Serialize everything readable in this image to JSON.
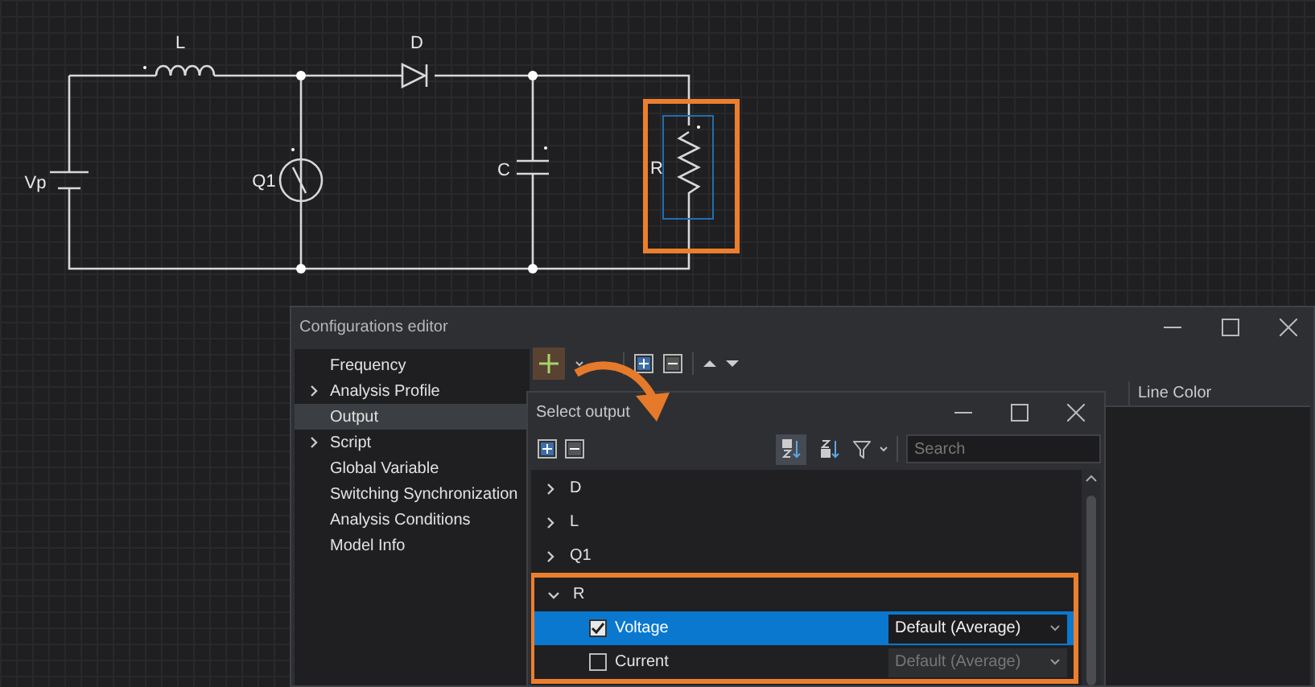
{
  "circuit": {
    "labels": [
      {
        "kind": "L",
        "text": "L"
      },
      {
        "kind": "D",
        "text": "D"
      },
      {
        "kind": "Vp",
        "text": "Vp"
      },
      {
        "kind": "Q1",
        "text": "Q1"
      },
      {
        "kind": "C",
        "text": "C"
      },
      {
        "kind": "R",
        "text": "R"
      }
    ]
  },
  "editor": {
    "title": "Configurations editor",
    "sidebar": [
      {
        "label": "Frequency",
        "expandable": false,
        "selected": false
      },
      {
        "label": "Analysis Profile",
        "expandable": true,
        "selected": false
      },
      {
        "label": "Output",
        "expandable": false,
        "selected": true
      },
      {
        "label": "Script",
        "expandable": true,
        "selected": false
      },
      {
        "label": "Global Variable",
        "expandable": false,
        "selected": false
      },
      {
        "label": "Switching Synchronization",
        "expandable": false,
        "selected": false
      },
      {
        "label": "Analysis Conditions",
        "expandable": false,
        "selected": false
      },
      {
        "label": "Model Info",
        "expandable": false,
        "selected": false
      }
    ],
    "table": {
      "columns": [
        "Line Color"
      ]
    }
  },
  "dialog": {
    "title": "Select output",
    "sort_buttons": [
      {
        "kind": "az",
        "selected": true
      },
      {
        "kind": "za",
        "selected": false
      }
    ],
    "search": {
      "placeholder": "Search"
    },
    "tree": [
      {
        "label": "D",
        "expanded": false,
        "highlighted": false
      },
      {
        "label": "L",
        "expanded": false,
        "highlighted": false
      },
      {
        "label": "Q1",
        "expanded": false,
        "highlighted": false
      },
      {
        "label": "R",
        "expanded": true,
        "highlighted": true,
        "children": [
          {
            "label": "Voltage",
            "checked": true,
            "selected": true,
            "mode": "Default (Average)",
            "disabled": false
          },
          {
            "label": "Current",
            "checked": false,
            "selected": false,
            "mode": "Default (Average)",
            "disabled": true
          }
        ]
      }
    ]
  }
}
